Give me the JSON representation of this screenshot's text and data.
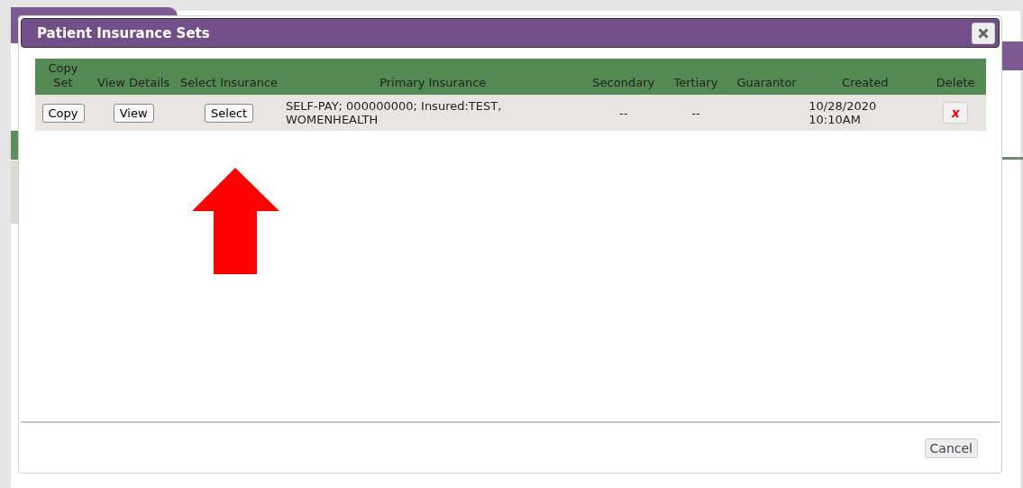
{
  "dialog": {
    "title": "Patient Insurance Sets",
    "table": {
      "columns": [
        "Copy Set",
        "View Details",
        "Select Insurance",
        "Primary Insurance",
        "Secondary",
        "Tertiary",
        "Guarantor",
        "Created",
        "Delete"
      ],
      "rows": [
        {
          "cells": [
            {
              "kind": "button",
              "text": "Copy"
            },
            {
              "kind": "button",
              "text": "View"
            },
            {
              "kind": "button",
              "text": "Select"
            },
            {
              "kind": "text",
              "text": "SELF-PAY; 000000000; Insured:TEST, WOMENHEALTH"
            },
            {
              "kind": "center",
              "text": "--"
            },
            {
              "kind": "center",
              "text": "--"
            },
            {
              "kind": "empty"
            },
            {
              "kind": "text",
              "text": "10/28/2020 10:10AM"
            },
            {
              "kind": "delete",
              "text": "x"
            }
          ]
        }
      ]
    },
    "buttons": [
      "Cancel"
    ]
  }
}
